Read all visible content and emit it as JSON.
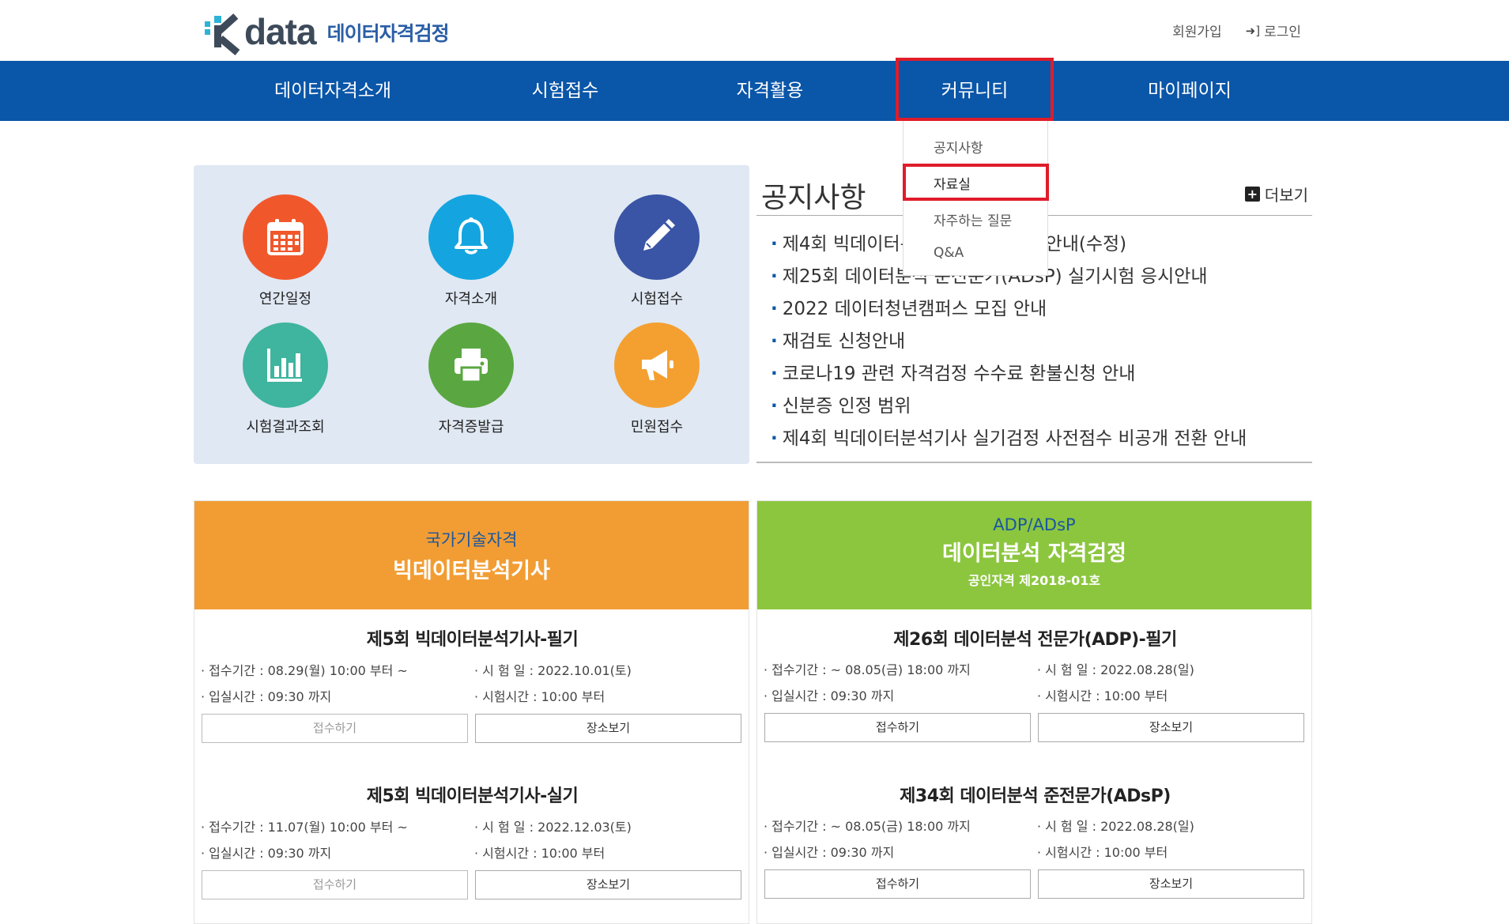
{
  "header": {
    "logo_word": "data",
    "logo_sub": "데이터자격검정",
    "signup": "회원가입",
    "login": "로그인"
  },
  "nav": {
    "items": [
      "데이터자격소개",
      "시험접수",
      "자격활용",
      "커뮤니티",
      "마이페이지"
    ]
  },
  "dropdown": {
    "items": [
      "공지사항",
      "자료실",
      "자주하는 질문",
      "Q&A"
    ]
  },
  "quick": {
    "items": [
      {
        "label": "연간일정",
        "icon": "calendar-icon",
        "color": "#f0582c"
      },
      {
        "label": "자격소개",
        "icon": "bell-icon",
        "color": "#14a5e0"
      },
      {
        "label": "시험접수",
        "icon": "pencil-icon",
        "color": "#3a55a5"
      },
      {
        "label": "시험결과조회",
        "icon": "bar-chart-icon",
        "color": "#3fb49f"
      },
      {
        "label": "자격증발급",
        "icon": "printer-icon",
        "color": "#5aa741"
      },
      {
        "label": "민원접수",
        "icon": "megaphone-icon",
        "color": "#f4a030"
      }
    ]
  },
  "notice": {
    "title": "공지사항",
    "more": "더보기",
    "items": [
      "제4회 빅데이터분석기사 실기검정 안내(수정)",
      "제25회 데이터분석 준전문가(ADsP) 실기시험 응시안내",
      "2022 데이터청년캠퍼스 모집 안내",
      "재검토 신청안내",
      "코로나19 관련 자격검정 수수료 환불신청 안내",
      "신분증 인정 범위",
      "제4회 빅데이터분석기사 실기검정 사전점수 비공개 전환 안내"
    ]
  },
  "card_left": {
    "color": "#f29d33",
    "small": "국가기술자격",
    "big": "빅데이터분석기사",
    "exams": [
      {
        "title": "제5회 빅데이터분석기사-필기",
        "period": "· 접수기간 : 08.29(월) 10:00 부터 ~",
        "date": "· 시 험 일  : 2022.10.01(토)",
        "entry": "· 입실시간 : 09:30 까지",
        "time": "· 시험시간 : 10:00 부터",
        "apply": "접수하기",
        "venue": "장소보기"
      },
      {
        "title": "제5회 빅데이터분석기사-실기",
        "period": "· 접수기간 : 11.07(월) 10:00 부터 ~",
        "date": "· 시 험 일  : 2022.12.03(토)",
        "entry": "· 입실시간 : 09:30 까지",
        "time": "· 시험시간 : 10:00 부터",
        "apply": "접수하기",
        "venue": "장소보기"
      }
    ]
  },
  "card_right": {
    "color": "#8cc63f",
    "small": "ADP/ADsP",
    "big": "데이터분석 자격검정",
    "sub": "공인자격 제2018-01호",
    "exams": [
      {
        "title": "제26회 데이터분석 전문가(ADP)-필기",
        "period": "· 접수기간 : ~ 08.05(금) 18:00 까지",
        "date": "· 시 험 일  : 2022.08.28(일)",
        "entry": "· 입실시간 : 09:30 까지",
        "time": "· 시험시간 : 10:00 부터",
        "apply": "접수하기",
        "venue": "장소보기"
      },
      {
        "title": "제34회 데이터분석 준전문가(ADsP)",
        "period": "· 접수기간 : ~ 08.05(금) 18:00 까지",
        "date": "· 시 험 일  : 2022.08.28(일)",
        "entry": "· 입실시간 : 09:30 까지",
        "time": "· 시험시간 : 10:00 부터",
        "apply": "접수하기",
        "venue": "장소보기"
      }
    ]
  }
}
